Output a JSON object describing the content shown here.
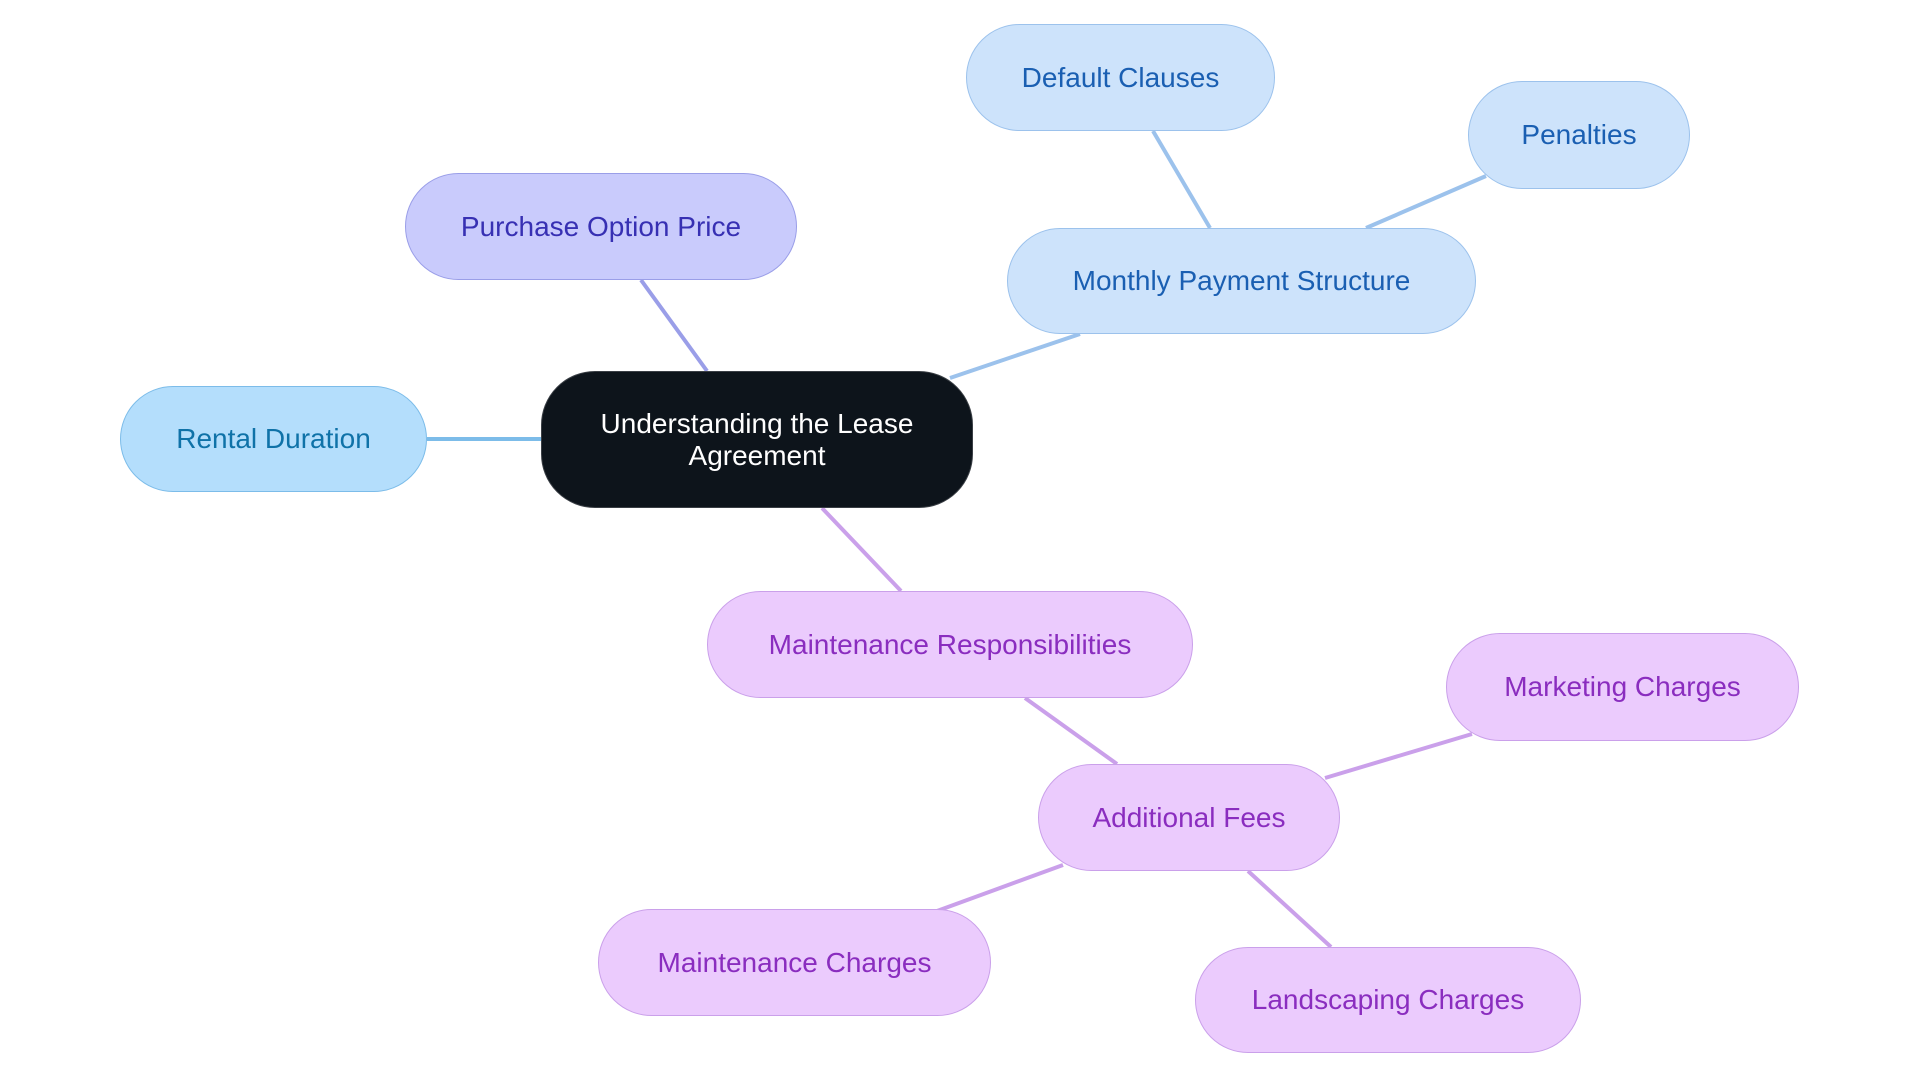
{
  "title": "Understanding the Lease Agreement",
  "colors": {
    "root": "#0d141b",
    "cyan_branch": "#7cbce9",
    "blue_branch": "#9cc2ec",
    "indigo_branch": "#9a9ee8",
    "purple_branch": "#caa0ea"
  },
  "nodes": {
    "root": "Understanding the Lease Agreement",
    "rental_duration": "Rental Duration",
    "purchase_option_price": "Purchase Option Price",
    "monthly_payment_structure": "Monthly Payment Structure",
    "default_clauses": "Default Clauses",
    "penalties": "Penalties",
    "maintenance_responsibilities": "Maintenance Responsibilities",
    "additional_fees": "Additional Fees",
    "marketing_charges": "Marketing Charges",
    "maintenance_charges": "Maintenance Charges",
    "landscaping_charges": "Landscaping Charges"
  },
  "edges": [
    {
      "from": "root",
      "to": "rental_duration"
    },
    {
      "from": "root",
      "to": "purchase_option_price"
    },
    {
      "from": "root",
      "to": "monthly_payment_structure"
    },
    {
      "from": "monthly_payment_structure",
      "to": "default_clauses"
    },
    {
      "from": "monthly_payment_structure",
      "to": "penalties"
    },
    {
      "from": "root",
      "to": "maintenance_responsibilities"
    },
    {
      "from": "maintenance_responsibilities",
      "to": "additional_fees"
    },
    {
      "from": "additional_fees",
      "to": "marketing_charges"
    },
    {
      "from": "additional_fees",
      "to": "maintenance_charges"
    },
    {
      "from": "additional_fees",
      "to": "landscaping_charges"
    }
  ]
}
